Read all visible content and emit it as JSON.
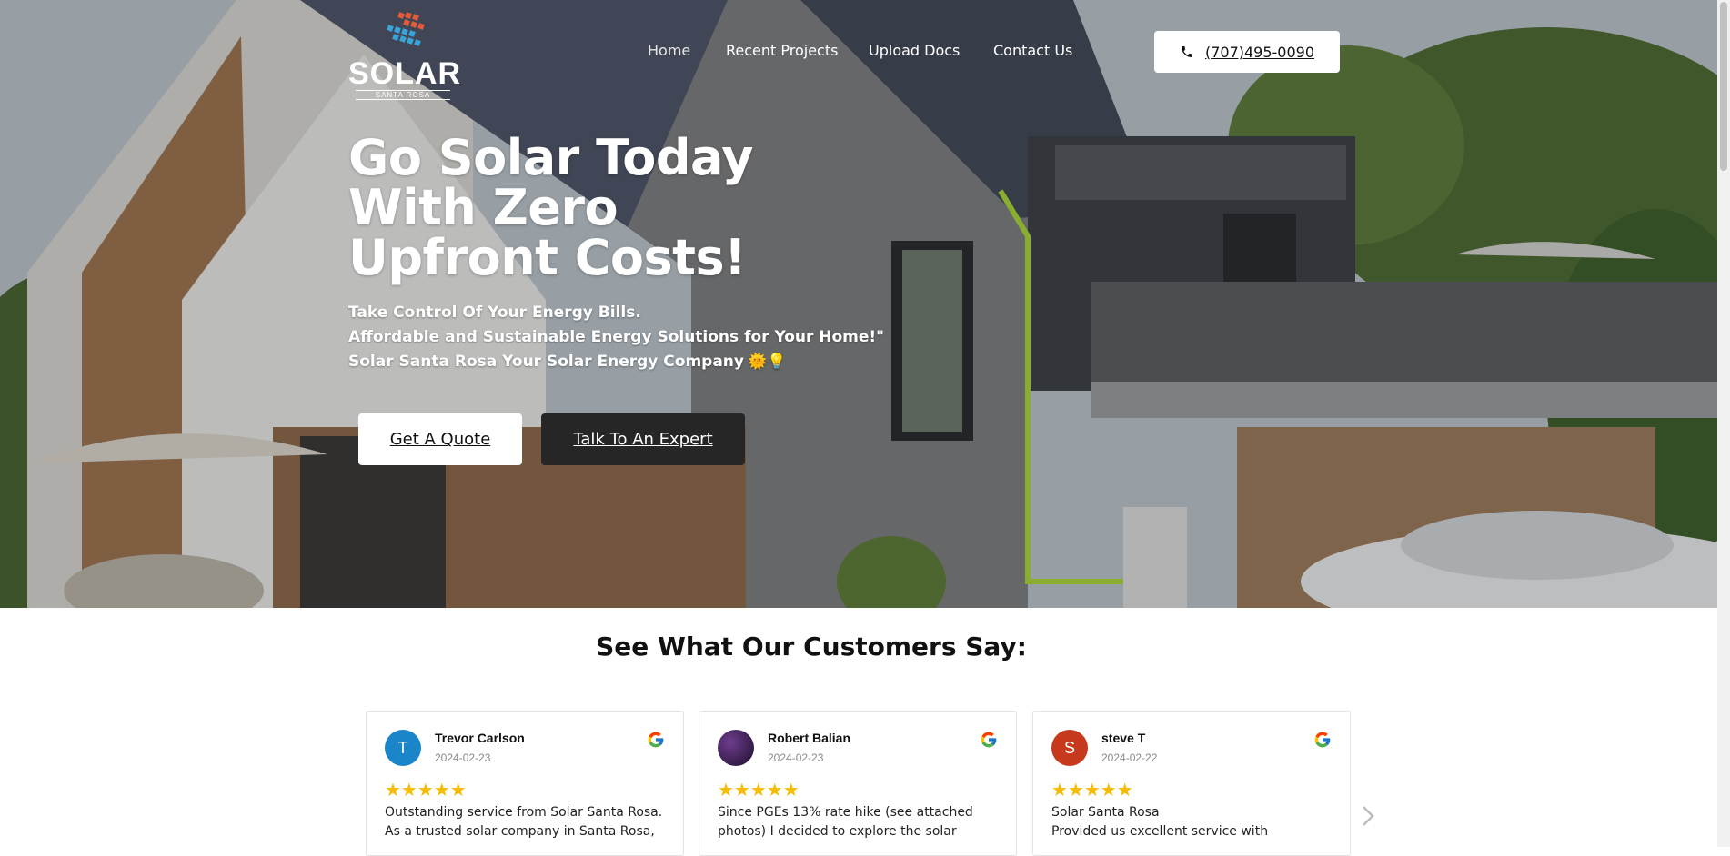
{
  "brand": {
    "logo_word": "SOLAR",
    "logo_sub": "SANTA ROSA"
  },
  "nav": {
    "items": [
      "Home",
      "Recent Projects",
      "Upload Docs",
      "Contact Us"
    ]
  },
  "header": {
    "phone": "(707)495-0090"
  },
  "hero": {
    "headline": "Go Solar Today With Zero Upfront Costs!",
    "lines": [
      "Take Control Of Your Energy Bills.",
      "Affordable and Sustainable Energy Solutions for Your Home!\"",
      "Solar Santa Rosa Your Solar Energy Company"
    ],
    "emoji": "🌞💡",
    "cta_primary": "Get A Quote",
    "cta_secondary": "Talk To An Expert"
  },
  "reviews": {
    "title": "See What Our Customers Say:",
    "stars": "★★★★★",
    "cards": [
      {
        "initial": "T",
        "avatar_color": "#1a85c9",
        "name": "Trevor Carlson",
        "date": "2024-02-23",
        "text": "Outstanding service from Solar Santa Rosa. As a trusted solar company in Santa Rosa,"
      },
      {
        "initial": "",
        "avatar_color": "#3a1f4f",
        "name": "Robert Balian",
        "date": "2024-02-23",
        "text": "Since PGEs 13% rate hike (see attached photos) I decided to explore the solar"
      },
      {
        "initial": "S",
        "avatar_color": "#c6391c",
        "name": "steve T",
        "date": "2024-02-22",
        "text": "Solar Santa Rosa\nProvided us excellent service with"
      }
    ]
  },
  "colors": {
    "star": "#f6bb06",
    "dark_button": "#262626"
  }
}
